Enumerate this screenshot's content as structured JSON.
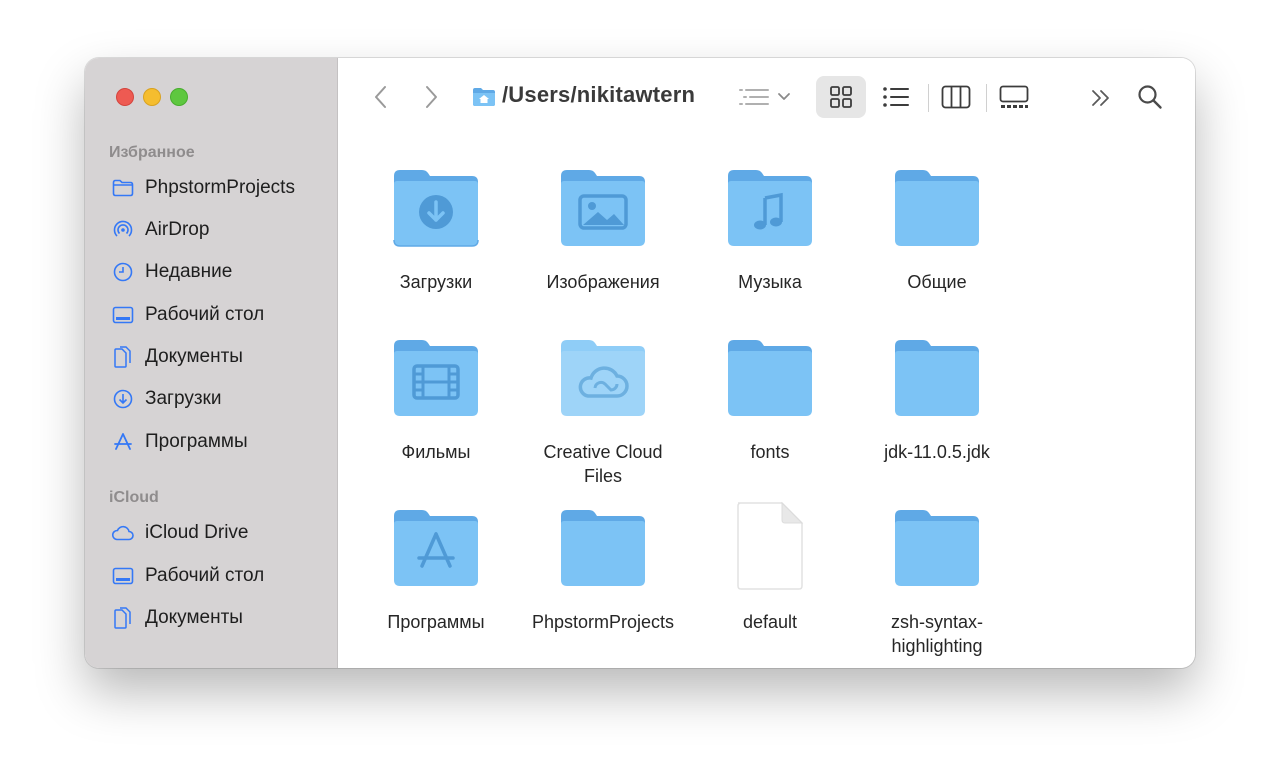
{
  "window": {
    "path": "/Users/nikitawtern"
  },
  "sidebar": {
    "favorites_title": "Избранное",
    "favorites": [
      {
        "label": "PhpstormProjects",
        "icon": "folder-icon"
      },
      {
        "label": "AirDrop",
        "icon": "airdrop-icon"
      },
      {
        "label": "Недавние",
        "icon": "clock-icon"
      },
      {
        "label": "Рабочий стол",
        "icon": "desktop-icon"
      },
      {
        "label": "Документы",
        "icon": "documents-icon"
      },
      {
        "label": "Загрузки",
        "icon": "download-icon"
      },
      {
        "label": "Программы",
        "icon": "applications-icon"
      }
    ],
    "icloud_title": "iCloud",
    "icloud": [
      {
        "label": "iCloud Drive",
        "icon": "cloud-icon"
      },
      {
        "label": "Рабочий стол",
        "icon": "desktop-icon"
      },
      {
        "label": "Документы",
        "icon": "documents-icon"
      }
    ]
  },
  "items": [
    {
      "name": "Загрузки",
      "kind": "folder",
      "glyph": "download"
    },
    {
      "name": "Изображения",
      "kind": "folder",
      "glyph": "picture"
    },
    {
      "name": "Музыка",
      "kind": "folder",
      "glyph": "music"
    },
    {
      "name": "Общие",
      "kind": "folder",
      "glyph": "none"
    },
    {
      "name": "Фильмы",
      "kind": "folder",
      "glyph": "film"
    },
    {
      "name": "Creative Cloud Files",
      "kind": "folder",
      "glyph": "creative-cloud"
    },
    {
      "name": "fonts",
      "kind": "folder",
      "glyph": "none"
    },
    {
      "name": "jdk-11.0.5.jdk",
      "kind": "folder",
      "glyph": "none"
    },
    {
      "name": "Программы",
      "kind": "folder",
      "glyph": "apps"
    },
    {
      "name": "PhpstormProjects",
      "kind": "folder",
      "glyph": "none"
    },
    {
      "name": "default",
      "kind": "file",
      "glyph": "none"
    },
    {
      "name": "zsh-syntax-highlighting",
      "kind": "folder",
      "glyph": "none"
    }
  ],
  "colors": {
    "folder_front": "#7cc3f5",
    "folder_back": "#5fa9e6",
    "folder_glyph": "#4f9ad6",
    "sidebar_icon": "#3478f6"
  }
}
